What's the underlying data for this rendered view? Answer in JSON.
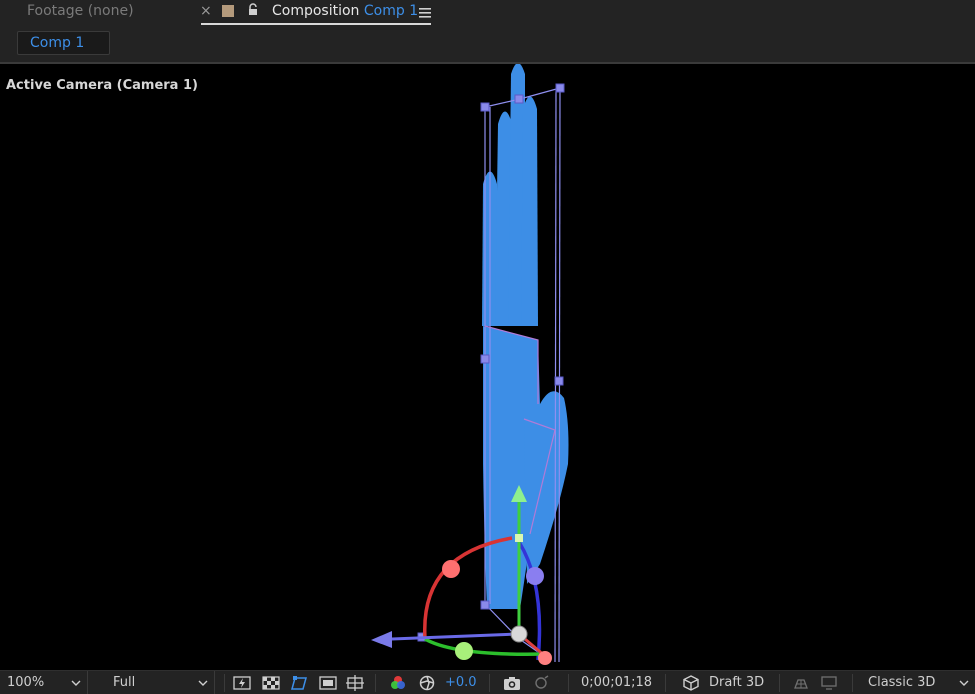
{
  "tabs": {
    "footage_label": "Footage",
    "footage_value": "(none)",
    "close_glyph": "×",
    "composition_prefix": "Composition",
    "composition_name": "Comp 1",
    "menu_icon": "hamburger-menu-icon",
    "lock_icon": "lock-icon"
  },
  "subbar": {
    "comp_pill_label": "Comp 1"
  },
  "viewer": {
    "camera_label": "Active Camera (Camera 1)",
    "layer_color": "#3d8ee6",
    "bounds_color": "#8f8ff0",
    "axis_colors": {
      "x": "#e03a3a",
      "y": "#3fcf3f",
      "z": "#3a3ae0"
    }
  },
  "toolbar": {
    "zoom": "100%",
    "resolution": "Full",
    "exposure": "+0.0",
    "timecode": "0;00;01;18",
    "renderer": "Draft 3D",
    "view_mode": "Classic 3D"
  }
}
